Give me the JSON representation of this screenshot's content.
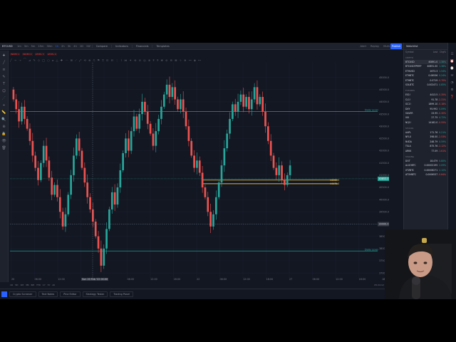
{
  "topbar": {
    "symbol": "BTCUSD",
    "timeframes": [
      "1m",
      "3m",
      "5m",
      "15m",
      "30m",
      "1h",
      "2h",
      "3h",
      "4h",
      "1D",
      "1W"
    ],
    "active_timeframe": "1h",
    "tools": [
      "Compare",
      "Indicators",
      "Financials",
      "Templates"
    ],
    "right_items": [
      "Alert",
      "Replay"
    ],
    "layout_label": "Multi-Charts",
    "publish_label": "Publish"
  },
  "indicators": [
    "INDEX 1",
    "INDEX 2",
    "LEVEL 3",
    "LEVEL 4"
  ],
  "left_tools": [
    "+",
    "╱",
    "≡",
    "✎",
    "T",
    "☺",
    "⋰",
    "⌖",
    "📏",
    "🔍",
    "⊕",
    "🔒",
    "👁",
    "🗑"
  ],
  "drawing_tools": [
    "╱",
    "→",
    "⇢",
    "⌒",
    "⊿",
    "✎",
    "◇",
    "□",
    "○",
    "⌀",
    "△",
    "✚",
    "⋯",
    "⊞",
    "⟋",
    "⤢",
    "⟲",
    "⊗",
    "⎍",
    "⚑",
    "⌶",
    "⊡",
    "⊟",
    "⋮",
    "⌇",
    "⋈",
    "✦",
    "⊛",
    "⊘",
    "◎",
    "⊗",
    "⌾",
    "⍟",
    "⎈",
    "⊜",
    "⊚",
    "⊠",
    "⊹",
    "⋇",
    "⊶",
    "◈",
    "⊷"
  ],
  "time_axis": {
    "labels": [
      "20",
      "06:00",
      "12:00",
      "18:00",
      "21",
      "06:00",
      "12:00",
      "18:00",
      "22",
      "06:00",
      "12:00",
      "18:00",
      "27",
      "06:00",
      "12:00",
      "18:00",
      "18:00"
    ],
    "cursor_label": "Sun 20 Feb '22  00:00"
  },
  "zoom_row": {
    "ranges": [
      "1D",
      "5D",
      "1M",
      "3M",
      "6M",
      "YTD",
      "1Y",
      "5Y",
      "All"
    ],
    "utc_label": "05:24:12 (UTC)"
  },
  "bottom_tabs": [
    "Crypto Screener",
    "Text Notes",
    "Pine Editor",
    "Strategy Tester",
    "Trading Panel"
  ],
  "chart_data": {
    "type": "candlestick",
    "x_label": "",
    "y_label": "",
    "ylim": [
      36800,
      45600
    ],
    "y_ticks": [
      45000,
      44500,
      44000,
      43500,
      43000,
      42500,
      42000,
      41500,
      41000,
      40500,
      40000,
      39500,
      39000,
      38500,
      38000,
      37500,
      37000
    ],
    "candles": [
      [
        44500,
        44100
      ],
      [
        44100,
        43700
      ],
      [
        43700,
        43200
      ],
      [
        43200,
        43800
      ],
      [
        43800,
        43300
      ],
      [
        43300,
        42900
      ],
      [
        42900,
        42400
      ],
      [
        42400,
        41800
      ],
      [
        41800,
        41300
      ],
      [
        41300,
        40800
      ],
      [
        40800,
        41500
      ],
      [
        41500,
        42200
      ],
      [
        42200,
        41600
      ],
      [
        41600,
        40900
      ],
      [
        40900,
        40200
      ],
      [
        40200,
        40600
      ],
      [
        40600,
        40100
      ],
      [
        40100,
        39500
      ],
      [
        39500,
        38900
      ],
      [
        38900,
        39400
      ],
      [
        39400,
        40200
      ],
      [
        40200,
        41000
      ],
      [
        41000,
        41800
      ],
      [
        41800,
        42500
      ],
      [
        42500,
        42000
      ],
      [
        42000,
        41300
      ],
      [
        41300,
        40700
      ],
      [
        40700,
        40100
      ],
      [
        40100,
        39600
      ],
      [
        39600,
        39100
      ],
      [
        39100,
        38500
      ],
      [
        38500,
        38000
      ],
      [
        38000,
        37300
      ],
      [
        37300,
        38000
      ],
      [
        38000,
        38800
      ],
      [
        38800,
        39600
      ],
      [
        39600,
        40300
      ],
      [
        40300,
        39800
      ],
      [
        39800,
        40500
      ],
      [
        40500,
        41200
      ],
      [
        41200,
        41900
      ],
      [
        41900,
        42500
      ],
      [
        42500,
        42000
      ],
      [
        42000,
        42800
      ],
      [
        42800,
        43400
      ],
      [
        43400,
        42900
      ],
      [
        42900,
        43500
      ],
      [
        43500,
        44000
      ],
      [
        44000,
        43600
      ],
      [
        43600,
        43100
      ],
      [
        43100,
        42700
      ],
      [
        42700,
        42200
      ],
      [
        42200,
        42800
      ],
      [
        42800,
        43300
      ],
      [
        43300,
        43800
      ],
      [
        43800,
        44300
      ],
      [
        44300,
        44700
      ],
      [
        44700,
        44200
      ],
      [
        44200,
        44600
      ],
      [
        44600,
        44100
      ],
      [
        44100,
        43700
      ],
      [
        43700,
        44100
      ],
      [
        44100,
        43600
      ],
      [
        43600,
        43000
      ],
      [
        43000,
        42400
      ],
      [
        42400,
        41800
      ],
      [
        41800,
        41300
      ],
      [
        41300,
        41600
      ],
      [
        41600,
        41100
      ],
      [
        41100,
        40500
      ],
      [
        40500,
        40100
      ],
      [
        40100,
        39500
      ],
      [
        39500,
        38900
      ],
      [
        38900,
        39400
      ],
      [
        39400,
        40100
      ],
      [
        40100,
        40700
      ],
      [
        40700,
        41400
      ],
      [
        41400,
        42100
      ],
      [
        42100,
        42700
      ],
      [
        42700,
        43300
      ],
      [
        43300,
        43900
      ],
      [
        43900,
        43600
      ],
      [
        43600,
        44000
      ],
      [
        44000,
        44300
      ],
      [
        44300,
        43800
      ],
      [
        43800,
        44200
      ],
      [
        44200,
        43700
      ],
      [
        43700,
        44100
      ],
      [
        44100,
        44600
      ],
      [
        44600,
        43900
      ],
      [
        43900,
        44200
      ],
      [
        44200,
        43600
      ],
      [
        43600,
        43000
      ],
      [
        43000,
        42400
      ],
      [
        42400,
        41800
      ],
      [
        41800,
        41300
      ],
      [
        41300,
        41000
      ],
      [
        41000,
        41400
      ],
      [
        41400,
        40800
      ],
      [
        40800,
        40600
      ],
      [
        40600,
        41000
      ],
      [
        41000,
        41400
      ]
    ],
    "levels": [
      {
        "name": "Daily Level",
        "value": 43600,
        "color": "#26a69a"
      },
      {
        "name": "Daily Level",
        "value": 37900,
        "color": "#26a69a"
      },
      {
        "name": "",
        "value": 40800,
        "color": "#f7c948"
      },
      {
        "name": "",
        "value": 40650,
        "color": "#f7c948"
      }
    ],
    "level_tags": [
      "44262.5",
      "44075.0"
    ],
    "last_price": "40853.0",
    "last_price_value": 40853,
    "cursor_price": "39000.0"
  },
  "watchlist": {
    "title": "Watchlist",
    "headers": [
      "Symbol",
      "Last",
      "Chg%"
    ],
    "sections": [
      {
        "name": "CRYPTO",
        "rows": [
          {
            "s": "BTCUSD",
            "l": "40891.0",
            "c": "1.38%",
            "d": "pos",
            "sel": true
          },
          {
            "s": "BTCUSDTPERP",
            "l": "40891.00",
            "c": "1.38%",
            "d": "pos"
          },
          {
            "s": "ETHUSD",
            "l": "2673.3",
            "c": "1.54%",
            "d": "pos"
          },
          {
            "s": "ETHBTC",
            "l": "0.06536",
            "c": "0.24%",
            "d": "pos"
          },
          {
            "s": "ETHBTC",
            "l": "0.0719",
            "c": "-0.70%",
            "d": "neg"
          },
          {
            "s": "SOLBTC",
            "l": "0.002471",
            "c": "0.85%",
            "d": "pos"
          }
        ]
      },
      {
        "name": "FUTURES",
        "rows": [
          {
            "s": "ES1!",
            "l": "4413.5",
            "c": "-0.35%",
            "d": "neg"
          },
          {
            "s": "CL1!",
            "l": "91.78",
            "c": "-2.31%",
            "d": "neg"
          },
          {
            "s": "GC1!",
            "l": "1899.10",
            "c": "-0.18%",
            "d": "neg"
          },
          {
            "s": "DXY",
            "l": "95.992",
            "c": "0.09%",
            "d": "pos"
          },
          {
            "s": "SILVER",
            "l": "23.95",
            "c": "-0.30%",
            "d": "neg"
          },
          {
            "s": "VIX",
            "l": "27.75",
            "c": "4.72%",
            "d": "pos"
          },
          {
            "s": "NQ1!",
            "l": "14182.0",
            "c": "-0.55%",
            "d": "neg"
          }
        ]
      },
      {
        "name": "STOCKS",
        "rows": [
          {
            "s": "AAPL",
            "l": "171.76",
            "c": "0.21%",
            "d": "pos"
          },
          {
            "s": "NFLX",
            "l": "398.00",
            "c": "-2.53%",
            "d": "neg"
          },
          {
            "s": "NVDA",
            "l": "248.79",
            "c": "0.59%",
            "d": "pos"
          },
          {
            "s": "TSLA",
            "l": "875.76",
            "c": "-2.12%",
            "d": "neg"
          },
          {
            "s": "ARKK",
            "l": "77.09",
            "c": "-1.61%",
            "d": "neg"
          }
        ]
      },
      {
        "name": "STAKING",
        "rows": [
          {
            "s": "DOT",
            "l": "18.479",
            "c": "0.80%",
            "d": "pos"
          },
          {
            "s": "ALGOBTC",
            "l": "0.00002195",
            "c": "2.09%",
            "d": "pos"
          },
          {
            "s": "XTZBTC",
            "l": "0.00008271",
            "c": "2.12%",
            "d": "pos"
          },
          {
            "s": "ATOMBTC",
            "l": "0.0006537",
            "c": "-0.64%",
            "d": "neg"
          }
        ]
      }
    ]
  },
  "right_strip": [
    "☰",
    "⏰",
    "⌚",
    "✉",
    "◔",
    "⚙",
    "❓"
  ]
}
